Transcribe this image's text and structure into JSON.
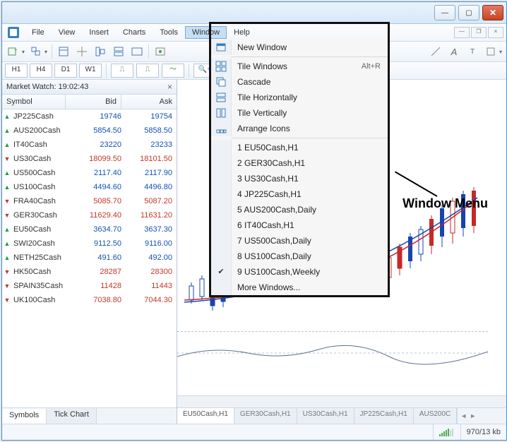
{
  "menubar": [
    "File",
    "View",
    "Insert",
    "Charts",
    "Tools",
    "Window",
    "Help"
  ],
  "timeframes": [
    "H1",
    "H4",
    "D1",
    "W1"
  ],
  "market_watch": {
    "title": "Market Watch: 19:02:43",
    "headers": {
      "symbol": "Symbol",
      "bid": "Bid",
      "ask": "Ask"
    },
    "rows": [
      {
        "symbol": "JP225Cash",
        "bid": "19746",
        "ask": "19754",
        "dir": "up",
        "color": "blue"
      },
      {
        "symbol": "AUS200Cash",
        "bid": "5854.50",
        "ask": "5858.50",
        "dir": "up",
        "color": "blue"
      },
      {
        "symbol": "IT40Cash",
        "bid": "23220",
        "ask": "23233",
        "dir": "up",
        "color": "blue"
      },
      {
        "symbol": "US30Cash",
        "bid": "18099.50",
        "ask": "18101.50",
        "dir": "down",
        "color": "red"
      },
      {
        "symbol": "US500Cash",
        "bid": "2117.40",
        "ask": "2117.90",
        "dir": "up",
        "color": "blue"
      },
      {
        "symbol": "US100Cash",
        "bid": "4494.60",
        "ask": "4496.80",
        "dir": "up",
        "color": "blue"
      },
      {
        "symbol": "FRA40Cash",
        "bid": "5085.70",
        "ask": "5087.20",
        "dir": "down",
        "color": "red"
      },
      {
        "symbol": "GER30Cash",
        "bid": "11629.40",
        "ask": "11631.20",
        "dir": "down",
        "color": "red"
      },
      {
        "symbol": "EU50Cash",
        "bid": "3634.70",
        "ask": "3637.30",
        "dir": "up",
        "color": "blue"
      },
      {
        "symbol": "SWI20Cash",
        "bid": "9112.50",
        "ask": "9116.00",
        "dir": "up",
        "color": "blue"
      },
      {
        "symbol": "NETH25Cash",
        "bid": "491.60",
        "ask": "492.00",
        "dir": "up",
        "color": "blue"
      },
      {
        "symbol": "HK50Cash",
        "bid": "28287",
        "ask": "28300",
        "dir": "down",
        "color": "red"
      },
      {
        "symbol": "SPAIN35Cash",
        "bid": "11428",
        "ask": "11443",
        "dir": "down",
        "color": "red"
      },
      {
        "symbol": "UK100Cash",
        "bid": "7038.80",
        "ask": "7044.30",
        "dir": "down",
        "color": "red"
      }
    ],
    "tabs": [
      "Symbols",
      "Tick Chart"
    ]
  },
  "window_menu": {
    "items_top": [
      {
        "label": "New Window",
        "icon": "new-window-icon"
      },
      {
        "label": "Tile Windows",
        "icon": "tile-icon",
        "shortcut": "Alt+R"
      },
      {
        "label": "Cascade",
        "icon": "cascade-icon"
      },
      {
        "label": "Tile Horizontally",
        "icon": "tile-h-icon"
      },
      {
        "label": "Tile Vertically",
        "icon": "tile-v-icon"
      },
      {
        "label": "Arrange Icons",
        "icon": "arrange-icon"
      }
    ],
    "items_windows": [
      "1 EU50Cash,H1",
      "2 GER30Cash,H1",
      "3 US30Cash,H1",
      "4 JP225Cash,H1",
      "5 AUS200Cash,Daily",
      "6 IT40Cash,H1",
      "7 US500Cash,Daily",
      "8 US100Cash,Daily",
      "9 US100Cash,Weekly"
    ],
    "checked_index": 8,
    "more": "More Windows..."
  },
  "chart_tabs": [
    "EU50Cash,H1",
    "GER30Cash,H1",
    "US30Cash,H1",
    "JP225Cash,H1",
    "AUS200C"
  ],
  "annotation": "Window Menu",
  "status": {
    "transfer": "970/13 kb"
  }
}
